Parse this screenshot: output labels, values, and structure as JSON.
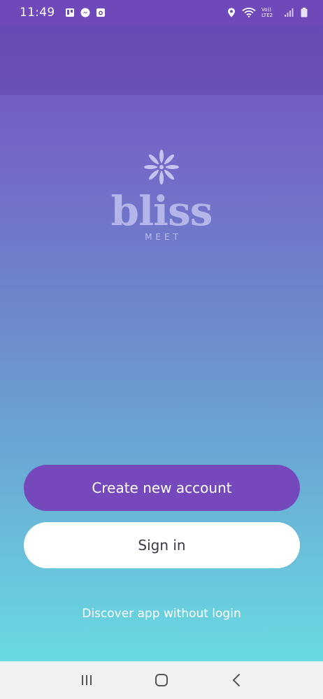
{
  "status_bar": {
    "time": "11:49",
    "left_icons": [
      "board-icon",
      "messenger-icon",
      "camera-icon"
    ],
    "right_icons": [
      "location-icon",
      "wifi-icon",
      "volte-icon",
      "signal-icon",
      "battery-icon"
    ],
    "volte_label": "Vo)) LTE2"
  },
  "logo": {
    "wordmark": "bliss",
    "subtitle": "MEET",
    "color": "#b4b6ea"
  },
  "actions": {
    "create_label": "Create new account",
    "signin_label": "Sign in",
    "discover_label": "Discover app without login"
  },
  "colors": {
    "primary": "#7548bb",
    "gradient_top": "#7450bd",
    "gradient_bottom": "#68e4e4"
  },
  "nav_bar": {
    "icons": [
      "recents-icon",
      "home-icon",
      "back-icon"
    ]
  }
}
